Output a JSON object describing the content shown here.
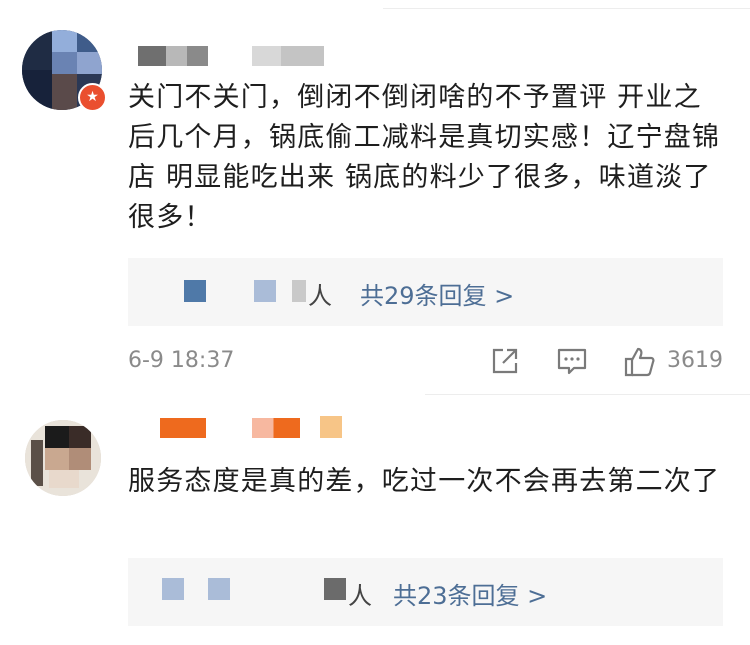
{
  "comments": [
    {
      "text": "关门不关门，倒闭不倒闭啥的不予置评 开业之后几个月，锅底偷工减料是真切实感！辽宁盘锦店 明显能吃出来 锅底的料少了很多，味道淡了很多！",
      "replies_preview_name_tail": "人",
      "replies_link": "共29条回复 >",
      "timestamp": "6-9 18:37",
      "like_count": "3619"
    },
    {
      "text": "服务态度是真的差，吃过一次不会再去第二次了",
      "replies_preview_name_tail": "人",
      "replies_link": "共23条回复 >"
    }
  ],
  "icons": {
    "share": "share-icon",
    "comment": "comment-icon",
    "like": "thumbs-up-icon",
    "badge": "star-badge-icon"
  },
  "colors": {
    "link": "#4d6e95",
    "meta": "#8a8a8a",
    "badge": "#ea4f2f",
    "reply_bg": "#f6f6f6"
  }
}
